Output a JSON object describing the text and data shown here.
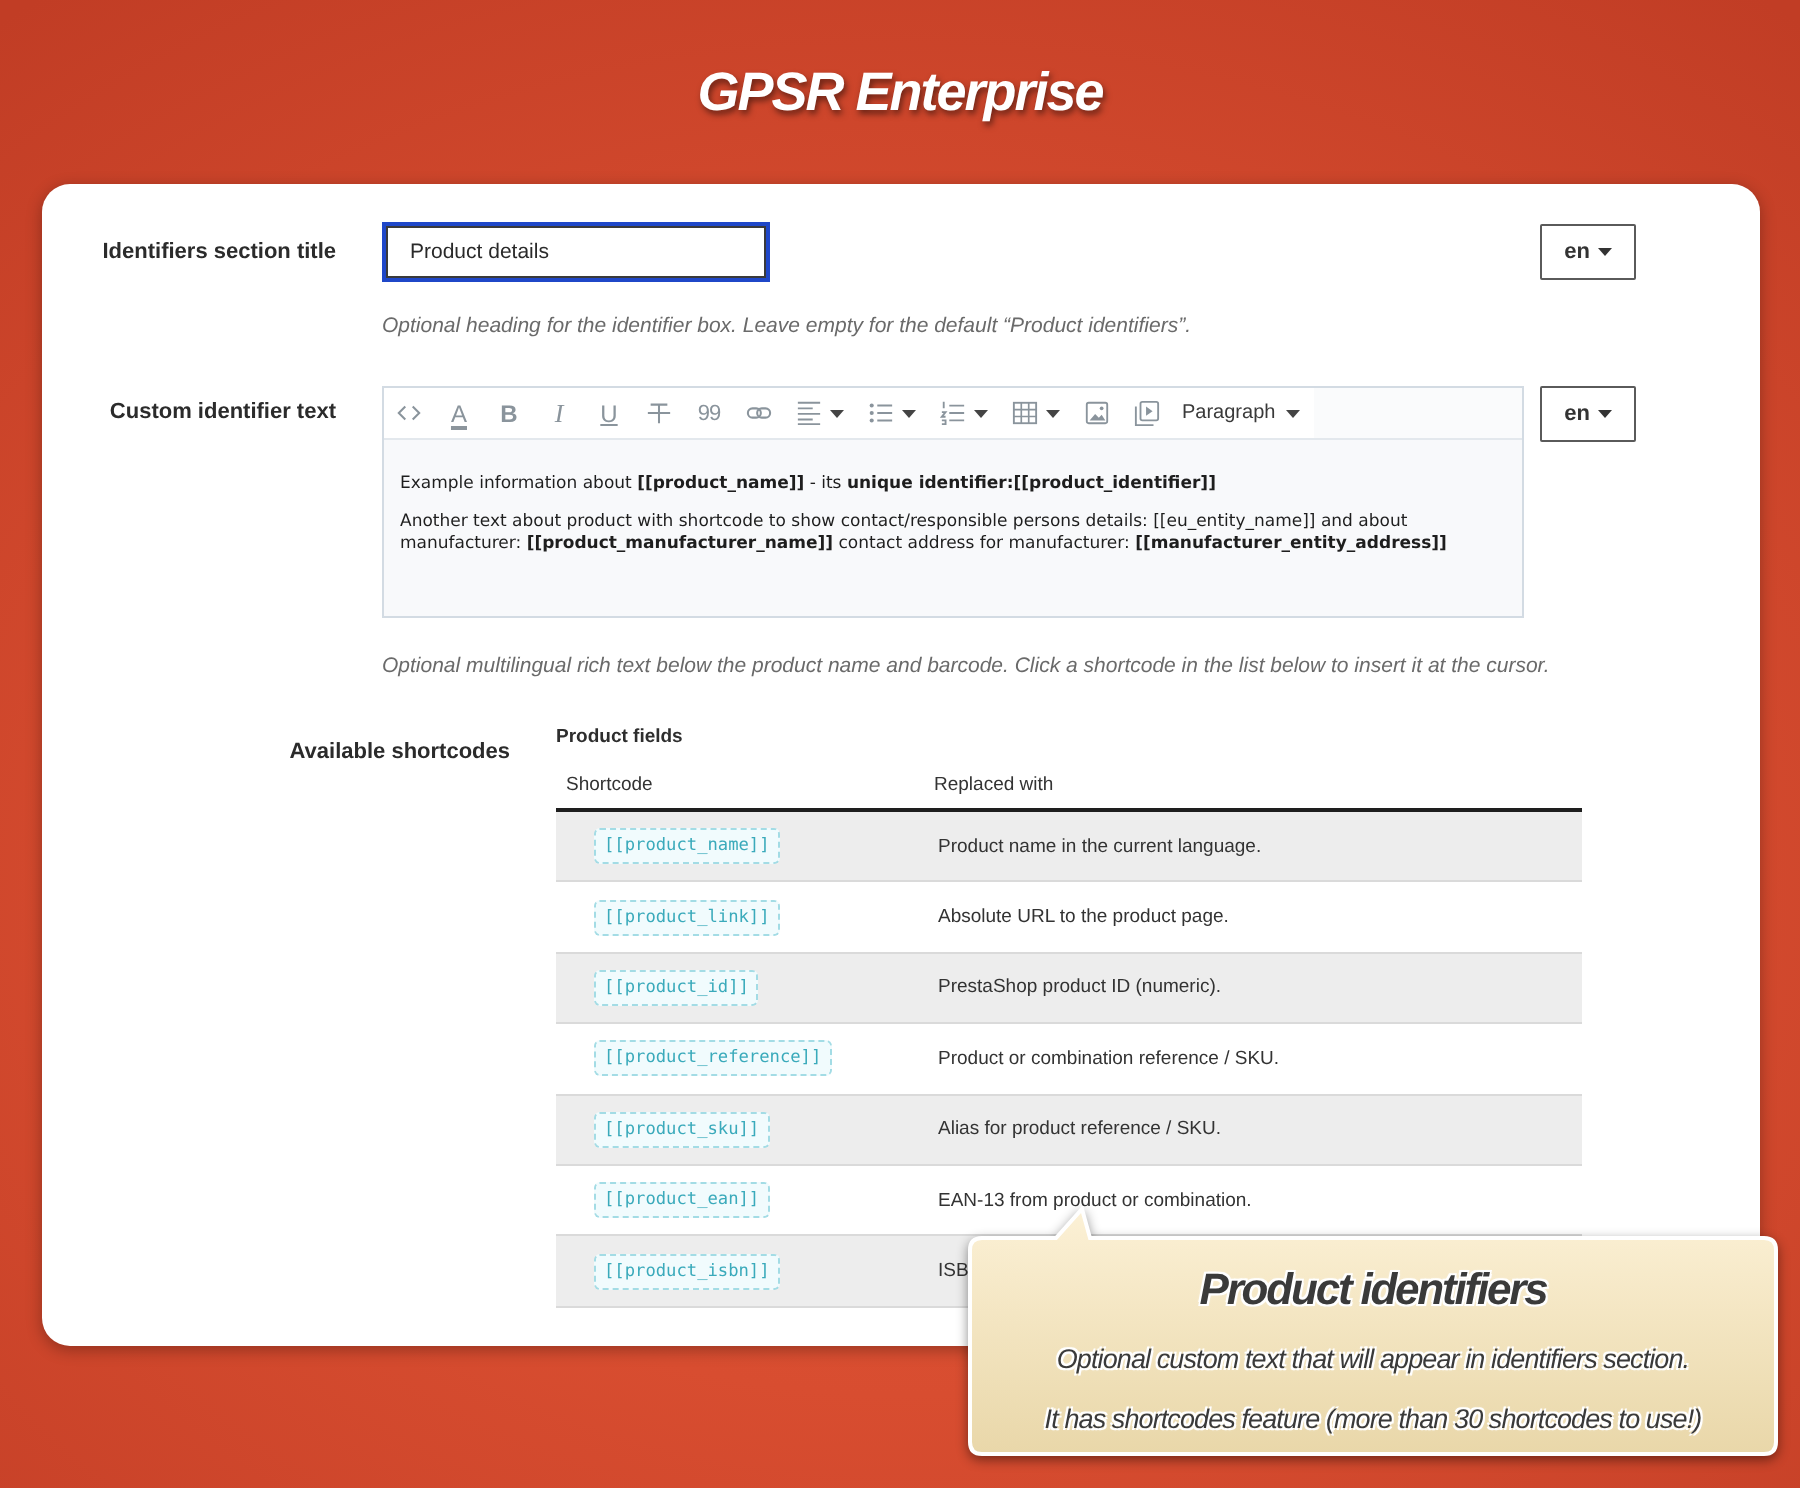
{
  "page": {
    "title": "GPSR Enterprise"
  },
  "section_title": {
    "label": "Identifiers section title",
    "value": "Product details",
    "focused": true,
    "language": "en",
    "hint": "Optional heading for the identifier box. Leave empty for the default “Product identifiers”."
  },
  "custom_text": {
    "label": "Custom identifier text",
    "toolbar": [
      {
        "kind": "source",
        "menu": false
      },
      {
        "kind": "font_color",
        "label": "A",
        "menu": false
      },
      {
        "kind": "bold",
        "label": "B",
        "menu": false
      },
      {
        "kind": "italic",
        "label": "I",
        "menu": false
      },
      {
        "kind": "underline",
        "label": "U",
        "menu": false
      },
      {
        "kind": "strikethrough",
        "menu": false
      },
      {
        "kind": "quote",
        "label": "99",
        "menu": false
      },
      {
        "kind": "link",
        "menu": false
      },
      {
        "kind": "align",
        "menu": true
      },
      {
        "kind": "bulleted_list",
        "menu": true
      },
      {
        "kind": "numbered_list",
        "menu": true
      },
      {
        "kind": "table",
        "menu": true
      },
      {
        "kind": "image",
        "menu": false
      },
      {
        "kind": "media",
        "menu": false
      },
      {
        "kind": "heading",
        "label": "Paragraph",
        "menu": true
      }
    ],
    "paragraphs": [
      "Example information about **[[product_name]]** - its **unique identifier:[[product_identifier]]**",
      "Another text about product with shortcode to show contact/responsible persons details: [[eu_entity_name]] and about manufacturer: **[[product_manufacturer_name]]** contact address for manufacturer: **[[manufacturer_entity_address]]**"
    ],
    "language": "en",
    "hint": "Optional multilingual rich text below the product name and barcode. Click a shortcode in the list below to insert it at the cursor."
  },
  "shortcodes": {
    "label": "Available shortcodes",
    "group_title": "Product fields",
    "columns": [
      "Shortcode",
      "Replaced with"
    ],
    "rows": [
      {
        "code": "[[product_name]]",
        "description": "Product name in the current language."
      },
      {
        "code": "[[product_link]]",
        "description": "Absolute URL to the product page."
      },
      {
        "code": "[[product_id]]",
        "description": "PrestaShop product ID (numeric)."
      },
      {
        "code": "[[product_reference]]",
        "description": "Product or combination reference / SKU."
      },
      {
        "code": "[[product_sku]]",
        "description": "Alias for product reference / SKU."
      },
      {
        "code": "[[product_ean]]",
        "description": "EAN-13 from product or combination."
      },
      {
        "code": "[[product_isbn]]",
        "description": "ISB"
      }
    ]
  },
  "callout": {
    "title": "Product identifiers",
    "lines": [
      "Optional custom text that will appear in identifiers section.",
      "It has shortcodes feature (more than 30 shortcodes to use!)"
    ]
  }
}
